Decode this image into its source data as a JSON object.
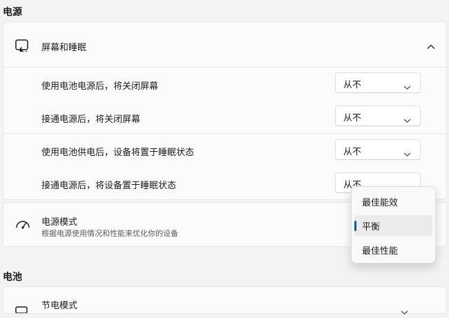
{
  "power_section": {
    "title": "电源"
  },
  "screen_sleep": {
    "title": "屏幕和睡眠",
    "icon": "monitor-sleep-icon",
    "expanded": true,
    "rows": [
      {
        "label": "使用电池电源后，将关闭屏幕",
        "value": "从不"
      },
      {
        "label": "接通电源后，将关闭屏幕",
        "value": "从不"
      },
      {
        "label": "使用电池供电后，设备将置于睡眠状态",
        "value": "从不"
      },
      {
        "label": "接通电源后，将设备置于睡眠状态",
        "value": "从不"
      }
    ]
  },
  "power_mode": {
    "title": "电源模式",
    "description": "根据电源使用情况和性能来优化你的设备",
    "icon": "gauge-icon",
    "options": [
      {
        "label": "最佳能效",
        "selected": false
      },
      {
        "label": "平衡",
        "selected": true
      },
      {
        "label": "最佳性能",
        "selected": false
      }
    ]
  },
  "battery_section": {
    "title": "电池"
  },
  "battery_saver": {
    "title": "节电模式",
    "icon": "battery-leaf-icon"
  },
  "colors": {
    "accent": "#005fb8",
    "background": "#f3f3f3",
    "card": "#fbfbfb"
  }
}
